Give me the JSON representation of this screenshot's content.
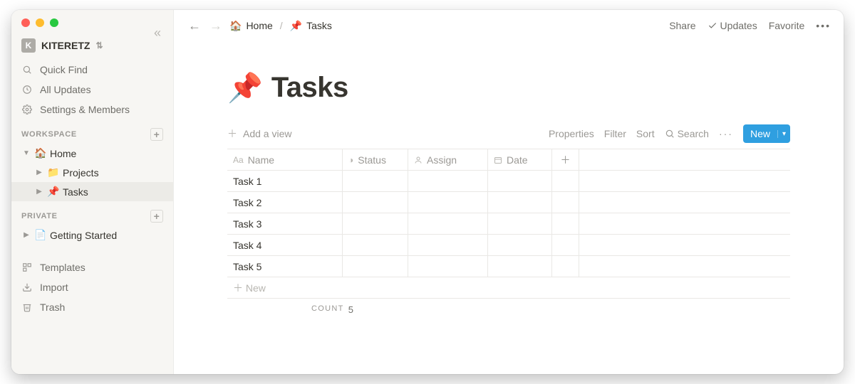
{
  "workspace": {
    "initial": "K",
    "name": "KITERETZ"
  },
  "sidebar": {
    "quick_find": "Quick Find",
    "all_updates": "All Updates",
    "settings": "Settings & Members",
    "section_workspace": "WORKSPACE",
    "section_private": "PRIVATE",
    "tree": {
      "home_icon": "🏠",
      "home": "Home",
      "projects_icon": "📁",
      "projects": "Projects",
      "tasks_icon": "📌",
      "tasks": "Tasks",
      "getting_started_icon": "📄",
      "getting_started": "Getting Started"
    },
    "templates": "Templates",
    "import": "Import",
    "trash": "Trash"
  },
  "topbar": {
    "crumb_home_icon": "🏠",
    "crumb_home": "Home",
    "crumb_tasks_icon": "📌",
    "crumb_tasks": "Tasks",
    "share": "Share",
    "updates": "Updates",
    "favorite": "Favorite"
  },
  "page": {
    "title_icon": "📌",
    "title": "Tasks"
  },
  "db": {
    "add_view": "Add a view",
    "properties": "Properties",
    "filter": "Filter",
    "sort": "Sort",
    "search": "Search",
    "new": "New",
    "columns": {
      "name": "Name",
      "status": "Status",
      "assign": "Assign",
      "date": "Date"
    },
    "rows": [
      {
        "name": "Task 1"
      },
      {
        "name": "Task 2"
      },
      {
        "name": "Task 3"
      },
      {
        "name": "Task 4"
      },
      {
        "name": "Task 5"
      }
    ],
    "new_row": "New",
    "count_label": "COUNT",
    "count_value": "5"
  }
}
